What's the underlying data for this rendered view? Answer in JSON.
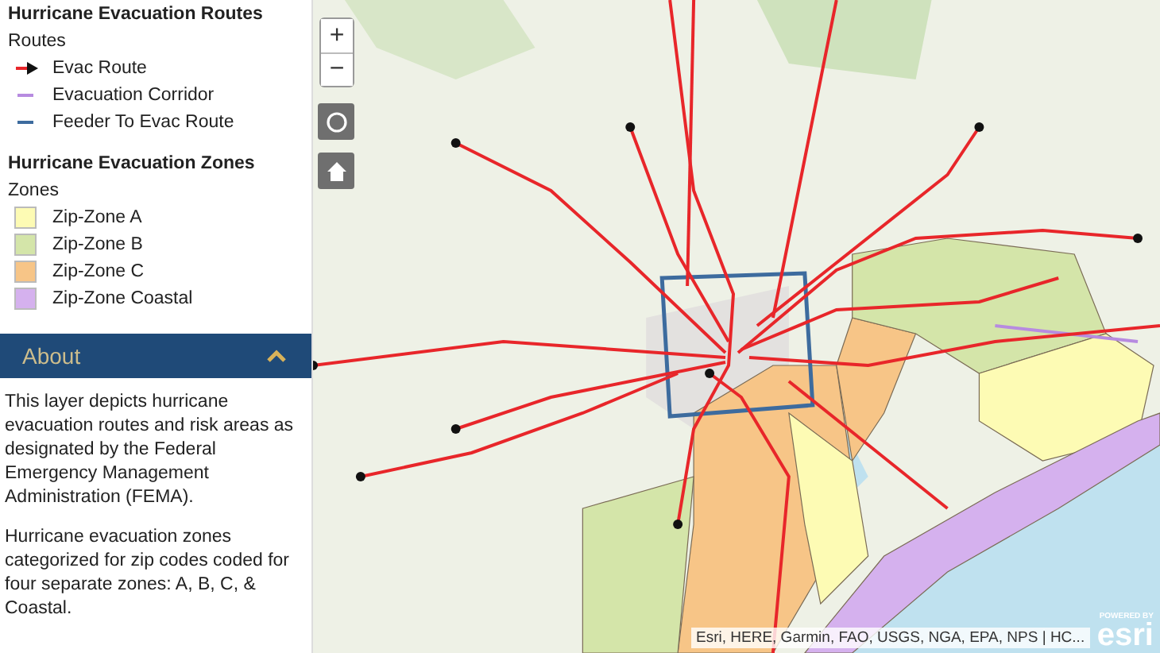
{
  "legend": {
    "routes_title": "Hurricane Evacuation Routes",
    "routes_heading": "Routes",
    "routes": [
      {
        "label": "Evac Route",
        "kind": "arrow",
        "color": "#e8262a"
      },
      {
        "label": "Evacuation Corridor",
        "kind": "line",
        "color": "#b78be0"
      },
      {
        "label": "Feeder To Evac Route",
        "kind": "line",
        "color": "#3d6b9e"
      }
    ],
    "zones_title": "Hurricane Evacuation Zones",
    "zones_heading": "Zones",
    "zones": [
      {
        "label": "Zip-Zone A",
        "color": "#fdfbb4"
      },
      {
        "label": "Zip-Zone B",
        "color": "#d4e5a9"
      },
      {
        "label": "Zip-Zone C",
        "color": "#f7c587"
      },
      {
        "label": "Zip-Zone Coastal",
        "color": "#d5b1ee"
      }
    ]
  },
  "about": {
    "title": "About",
    "expanded": true,
    "paragraphs": [
      "This layer depicts hurricane evacuation routes and risk areas as designated by the Federal Emergency Management Administration (FEMA).",
      "Hurricane evacuation zones categorized for zip codes coded for four separate zones: A, B, C, & Coastal."
    ]
  },
  "map": {
    "zoom_in": "+",
    "zoom_out": "−",
    "attribution": "Esri, HERE, Garmin, FAO, USGS, NGA, EPA, NPS | HC...",
    "logo_caption": "POWERED BY",
    "logo": "esri"
  }
}
